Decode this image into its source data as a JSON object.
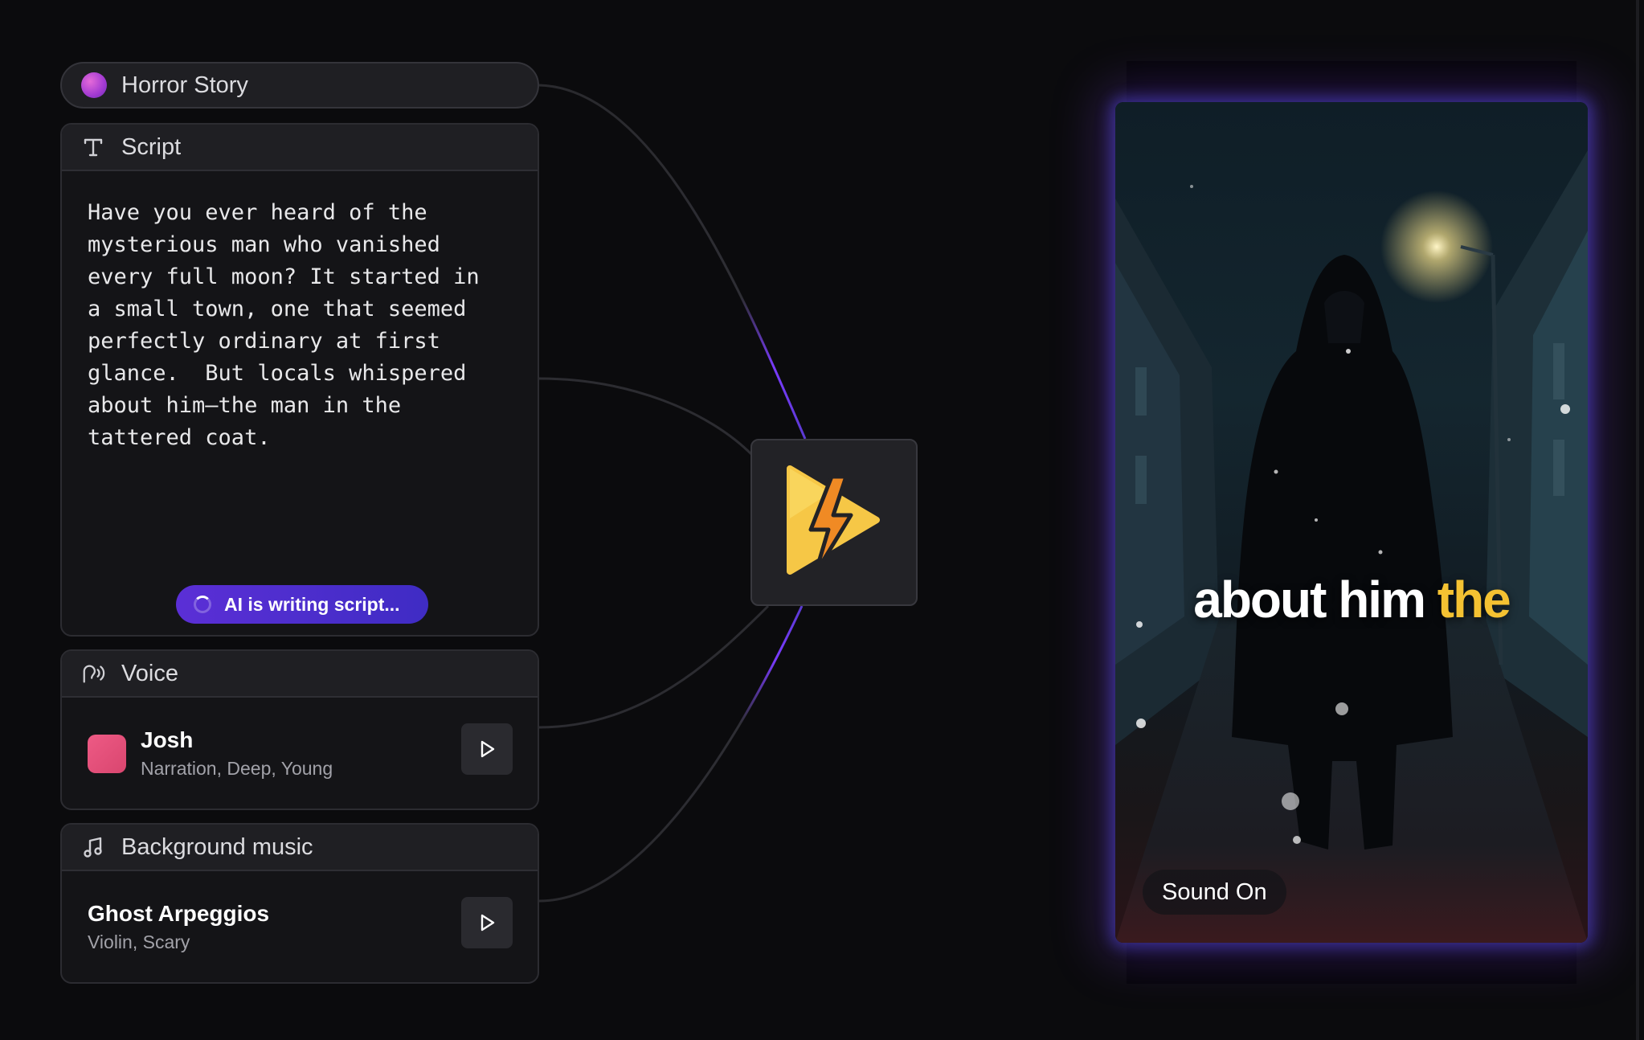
{
  "topic": {
    "label": "Horror Story"
  },
  "script": {
    "title": "Script",
    "text": "Have you ever heard of the\nmysterious man who vanished\nevery full moon? It started in\na small town, one that seemed\nperfectly ordinary at first\nglance.  But locals whispered\nabout him—the man in the\ntattered coat.",
    "ai_status": "AI is writing script..."
  },
  "voice": {
    "title": "Voice",
    "name": "Josh",
    "tags": "Narration, Deep, Young"
  },
  "music": {
    "title": "Background music",
    "name": "Ghost Arpeggios",
    "tags": "Violin, Scary"
  },
  "preview": {
    "caption_plain": "about him ",
    "caption_highlight": "the",
    "sound_label": "Sound On"
  },
  "colors": {
    "accent_purple": "#5b2fd6",
    "caption_highlight": "#f4c232",
    "voice_avatar": "#e8507c",
    "bolt_yellow": "#f6c746"
  }
}
